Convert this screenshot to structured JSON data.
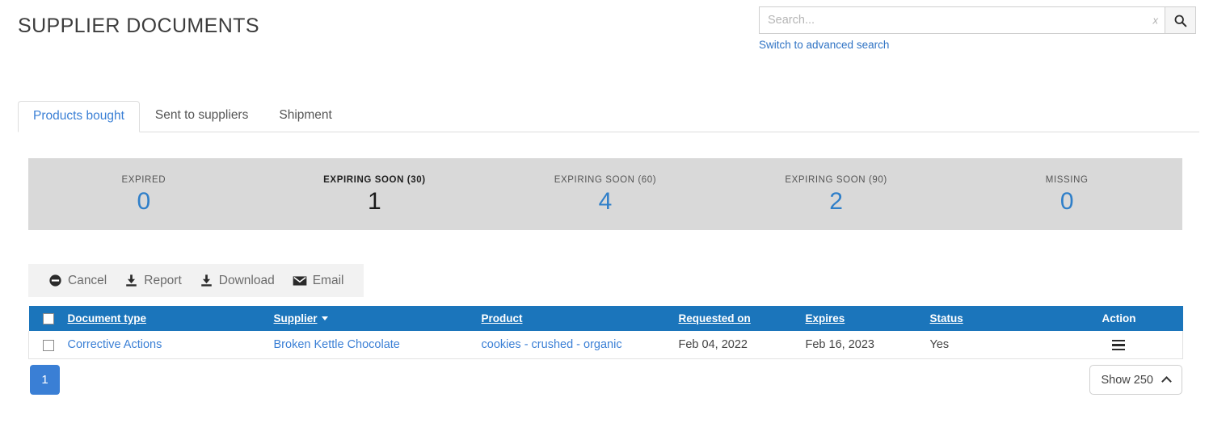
{
  "header": {
    "title": "SUPPLIER DOCUMENTS",
    "search": {
      "placeholder": "Search...",
      "value": "",
      "clear_label": "x",
      "search_icon": "search-icon"
    },
    "advanced_search_link": "Switch to advanced search"
  },
  "tabs": [
    {
      "label": "Products bought",
      "active": true
    },
    {
      "label": "Sent to suppliers",
      "active": false
    },
    {
      "label": "Shipment",
      "active": false
    }
  ],
  "stats": [
    {
      "label": "EXPIRED",
      "value": "0",
      "active": false
    },
    {
      "label": "EXPIRING SOON (30)",
      "value": "1",
      "active": true
    },
    {
      "label": "EXPIRING SOON (60)",
      "value": "4",
      "active": false
    },
    {
      "label": "EXPIRING SOON (90)",
      "value": "2",
      "active": false
    },
    {
      "label": "MISSING",
      "value": "0",
      "active": false
    }
  ],
  "toolbar": [
    {
      "label": "Cancel",
      "icon": "ban-icon"
    },
    {
      "label": "Report",
      "icon": "download-icon"
    },
    {
      "label": "Download",
      "icon": "download-icon"
    },
    {
      "label": "Email",
      "icon": "envelope-icon"
    }
  ],
  "table": {
    "columns": [
      {
        "label": "Document type",
        "sortable": true,
        "sorted": false
      },
      {
        "label": "Supplier",
        "sortable": true,
        "sorted": true,
        "sort_dir": "desc"
      },
      {
        "label": "Product",
        "sortable": true,
        "sorted": false
      },
      {
        "label": "Requested on",
        "sortable": true,
        "sorted": false
      },
      {
        "label": "Expires",
        "sortable": true,
        "sorted": false
      },
      {
        "label": "Status",
        "sortable": true,
        "sorted": false
      },
      {
        "label": "Action",
        "sortable": false,
        "sorted": false
      }
    ],
    "rows": [
      {
        "document_type": "Corrective Actions",
        "supplier": "Broken Kettle Chocolate",
        "product": "cookies - crushed - organic",
        "requested_on": "Feb 04, 2022",
        "expires": "Feb 16, 2023",
        "status": "Yes",
        "action_icon": "hamburger-menu-icon"
      }
    ]
  },
  "footer": {
    "pages": [
      "1"
    ],
    "current_page": "1",
    "show_label": "Show 250"
  },
  "colors": {
    "accent_blue": "#3a7fd5",
    "table_header_blue": "#1b75bb",
    "stats_gray": "#d9d9d9",
    "toolbar_gray": "#f2f2f2"
  }
}
